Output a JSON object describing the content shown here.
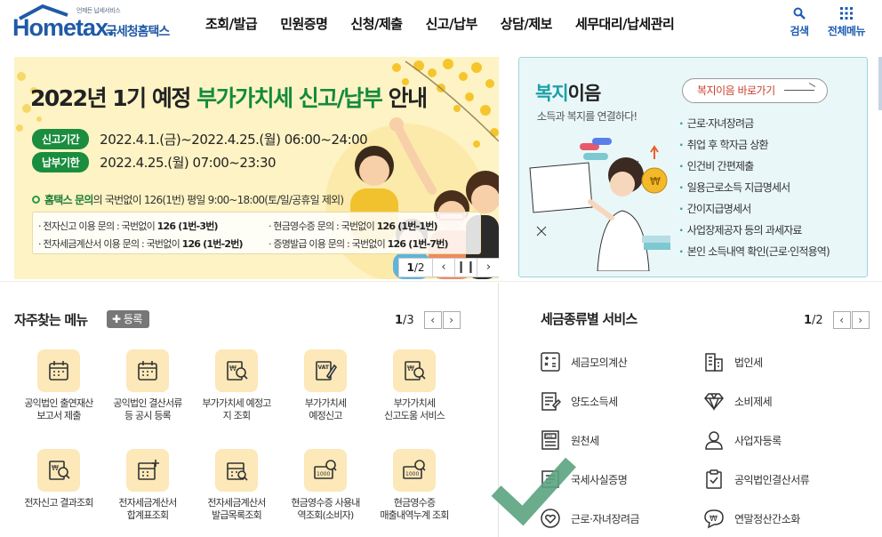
{
  "header": {
    "logo_tagline": "언제든 납세서비스",
    "logo_text": "Hometax.",
    "logo_kor": "국세청홈택스",
    "nav": [
      "조회/발급",
      "민원증명",
      "신청/제출",
      "신고/납부",
      "상담/제보",
      "세무대리/납세관리"
    ],
    "search_label": "검색",
    "menu_label": "전체메뉴"
  },
  "banner": {
    "title_prefix": "2022년 1기 예정 ",
    "title_highlight": "부가가치세 신고/납부",
    "title_suffix": " 안내",
    "rows": [
      {
        "tag": "신고기간",
        "value": "2022.4.1.(금)~2022.4.25.(월) 06:00~24:00"
      },
      {
        "tag": "납부기한",
        "value": "2022.4.25.(월) 07:00~23:30"
      }
    ],
    "contact_label": "홈택스 문의",
    "contact_text": " 의 국번없이 126(1번) 평일 9:00~18:00(토/일/공휴일 제외)",
    "info": [
      {
        "label": "· 전자신고 이용 문의 : 국번없이 ",
        "bold": "126 (1번-3번)"
      },
      {
        "label": "· 현금영수증 문의 : 국번없이 ",
        "bold": "126 (1번-1번)"
      },
      {
        "label": "· 전자세금계산서 이용 문의 : 국번없이 ",
        "bold": "126 (1번-2번)"
      },
      {
        "label": "· 증명발급 이용 문의 : 국번없이 ",
        "bold": "126 (1번-7번)"
      }
    ],
    "page_current": "1",
    "page_total": "/2"
  },
  "welfare": {
    "title_highlight": "복지",
    "title_rest": "이음",
    "subtitle": "소득과 복지를 연결하다!",
    "button_label": "복지이음 바로가기",
    "items": [
      "근로·자녀장려금",
      "취업 후 학자금 상환",
      "인건비 간편제출",
      "일용근로소득 지급명세서",
      "간이지급명세서",
      "사업장제공자 등의 과세자료",
      "본인 소득내역 확인(근로·인적용역)"
    ]
  },
  "favorites": {
    "title": "자주찾는 메뉴",
    "register_label": "등록",
    "page_current": "1",
    "page_total": "/3",
    "items": [
      {
        "line1": "공익법인 출연재산",
        "line2": "보고서 제출",
        "icon": "calendar-doc-icon"
      },
      {
        "line1": "공익법인 결산서류",
        "line2": "등 공시 등록",
        "icon": "calendar-doc-icon"
      },
      {
        "line1": "부가가치세 예정고",
        "line2": "지 조회",
        "icon": "won-search-icon"
      },
      {
        "line1": "부가가치세",
        "line2": "예정신고",
        "icon": "vat-doc-icon"
      },
      {
        "line1": "부가가치세",
        "line2": "신고도움 서비스",
        "icon": "won-search-icon"
      },
      {
        "line1": "전자신고 결과조회",
        "line2": "",
        "icon": "won-search-icon"
      },
      {
        "line1": "전자세금계산서",
        "line2": "합계표조회",
        "icon": "calc-plus-icon"
      },
      {
        "line1": "전자세금계산서",
        "line2": "발급목록조회",
        "icon": "calc-search-icon"
      },
      {
        "line1": "현금영수증 사용내",
        "line2": "역조회(소비자)",
        "icon": "receipt-search-icon"
      },
      {
        "line1": "현금영수증",
        "line2": "매출내역누계 조회",
        "icon": "receipt-search-icon"
      }
    ]
  },
  "tax_services": {
    "title": "세금종류별 서비스",
    "page_current": "1",
    "page_total": "/2",
    "items": [
      {
        "label": "세금모의계산",
        "icon": "calculator-icon"
      },
      {
        "label": "법인세",
        "icon": "building-icon"
      },
      {
        "label": "양도소득세",
        "icon": "transfer-doc-icon"
      },
      {
        "label": "소비제세",
        "icon": "diamond-icon"
      },
      {
        "label": "원천세",
        "icon": "salary-doc-icon"
      },
      {
        "label": "사업자등록",
        "icon": "person-icon"
      },
      {
        "label": "국세사실증명",
        "icon": "certificate-icon"
      },
      {
        "label": "공익법인결산서류",
        "icon": "clipboard-icon"
      },
      {
        "label": "근로·자녀장려금",
        "icon": "heart-hand-icon"
      },
      {
        "label": "연말정산간소화",
        "icon": "won-bubble-icon"
      }
    ]
  },
  "colors": {
    "brand": "#1f5aa6",
    "accent_green": "#1a8d3e",
    "welfare_teal": "#1b9fa8",
    "icon_bg": "#fce8b8"
  }
}
